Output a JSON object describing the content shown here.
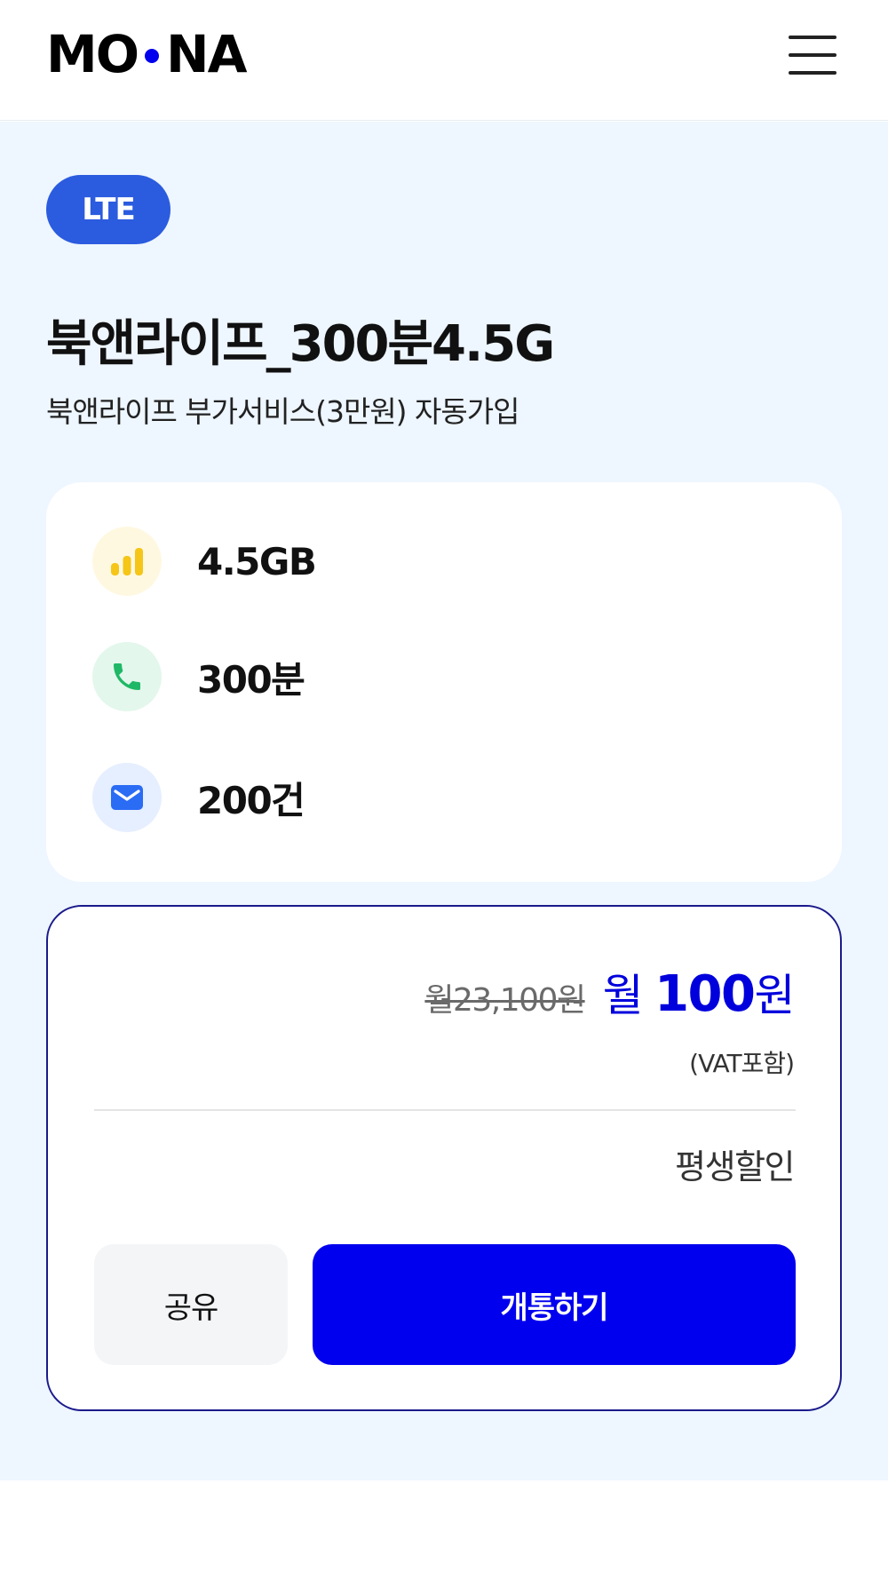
{
  "header": {
    "logo_left": "MO",
    "logo_right": "NA",
    "menu_icon": "hamburger-menu-icon"
  },
  "plan": {
    "badge": "LTE",
    "title": "북앤라이프_300분4.5G",
    "subtitle": "북앤라이프 부가서비스(3만원) 자동가입"
  },
  "features": [
    {
      "icon": "signal-bars-icon",
      "value": "4.5GB",
      "icon_color": "#f5c518",
      "icon_bg": "#fff8e1"
    },
    {
      "icon": "phone-icon",
      "value": "300분",
      "icon_color": "#1fb866",
      "icon_bg": "#e3f7ec"
    },
    {
      "icon": "mail-icon",
      "value": "200건",
      "icon_color": "#2b6cf5",
      "icon_bg": "#e6efff"
    }
  ],
  "pricing": {
    "original_price": "월23,100원",
    "sale_prefix": "월",
    "sale_amount": "100",
    "sale_unit": "원",
    "vat_note": "(VAT포함)",
    "discount_label": "평생할인"
  },
  "actions": {
    "share_label": "공유",
    "activate_label": "개통하기"
  },
  "colors": {
    "brand_blue": "#0000ee",
    "badge_blue": "#2b5bde",
    "page_bg": "#eef6ff"
  }
}
